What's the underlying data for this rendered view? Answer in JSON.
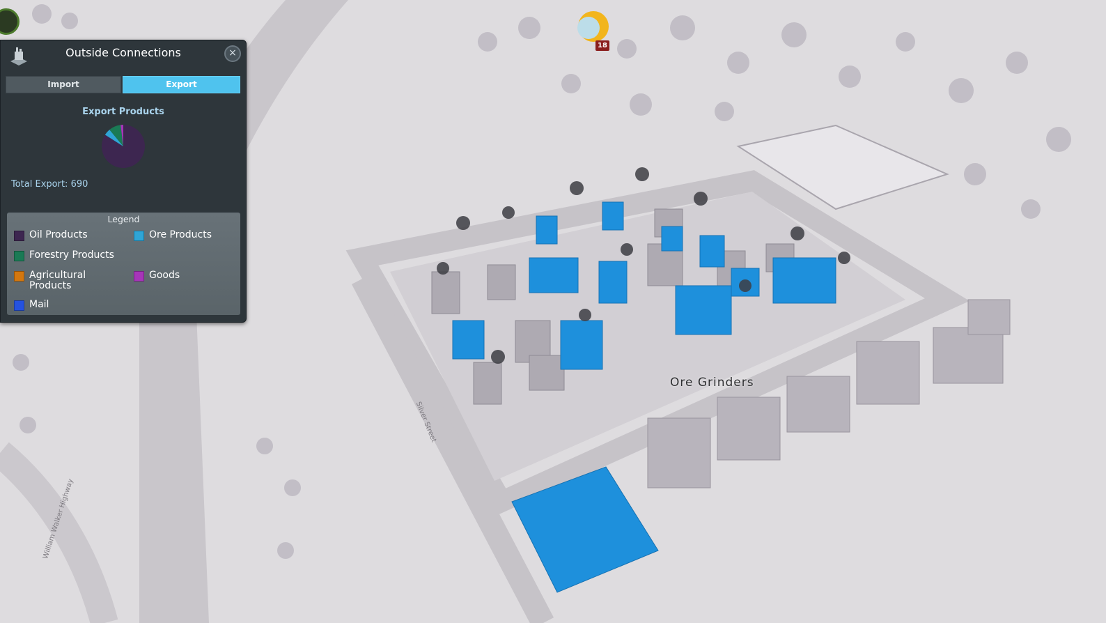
{
  "panel": {
    "title": "Outside Connections",
    "close_label": "×",
    "tabs": [
      {
        "label": "Import",
        "active": false
      },
      {
        "label": "Export",
        "active": true
      }
    ],
    "chart_title": "Export Products",
    "total": {
      "label": "Total Export:",
      "value": "690"
    },
    "legend_title": "Legend"
  },
  "chart_data": {
    "type": "pie",
    "title": "Export Products",
    "series": [
      {
        "name": "Oil Products",
        "value": 84,
        "color": "#3d2650"
      },
      {
        "name": "Ore Products",
        "value": 5,
        "color": "#2fa5d6"
      },
      {
        "name": "Forestry Products",
        "value": 9,
        "color": "#1a7a55"
      },
      {
        "name": "Agricultural Products",
        "value": 0,
        "color": "#d3770f"
      },
      {
        "name": "Goods",
        "value": 2,
        "color": "#a635b8"
      },
      {
        "name": "Mail",
        "value": 0,
        "color": "#2552e0"
      }
    ]
  },
  "legend": [
    {
      "label": "Oil Products",
      "color": "#3d2650"
    },
    {
      "label": "Ore Products",
      "color": "#2fa5d6"
    },
    {
      "label": "Forestry Products",
      "color": "#1a7a55"
    },
    {
      "label": "Agricultural Products",
      "color": "#d3770f"
    },
    {
      "label": "Goods",
      "color": "#a635b8"
    },
    {
      "label": "Mail",
      "color": "#2552e0"
    }
  ],
  "map": {
    "district_label": "Ore Grinders",
    "unit_count": "18",
    "highway_name": "William Walker Highway",
    "street_name": "Silver Street"
  },
  "colors": {
    "highlight": "#1e90dc",
    "ground": "#dedcdf"
  }
}
